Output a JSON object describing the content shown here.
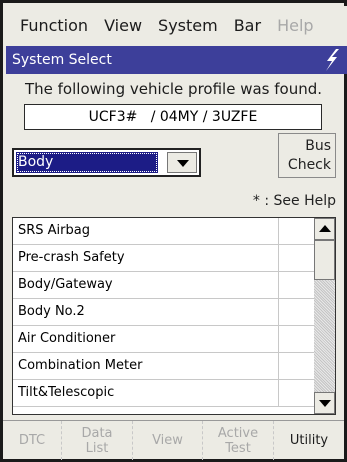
{
  "menu": {
    "items": [
      {
        "label": "Function",
        "disabled": false
      },
      {
        "label": "View",
        "disabled": false
      },
      {
        "label": "System",
        "disabled": false
      },
      {
        "label": "Bar",
        "disabled": false
      },
      {
        "label": "Help",
        "disabled": true
      }
    ]
  },
  "title": "System Select",
  "info_text": "The following vehicle profile was found.",
  "profile": "UCF3#   / 04MY / 3UZFE",
  "system_select": {
    "value": "Body"
  },
  "bus_check": {
    "line1": "Bus",
    "line2": "Check"
  },
  "see_help": "* : See Help",
  "systems": [
    "SRS Airbag",
    "Pre-crash Safety",
    "Body/Gateway",
    "Body No.2",
    "Air Conditioner",
    "Combination Meter",
    "Tilt&Telescopic"
  ],
  "toolbar": {
    "dtc": "DTC",
    "data_list_1": "Data",
    "data_list_2": "List",
    "view": "View",
    "active_test_1": "Active",
    "active_test_2": "Test",
    "utility": "Utility"
  },
  "colors": {
    "title_bg": "#3d3f9a",
    "selection": "#1c1c86"
  }
}
